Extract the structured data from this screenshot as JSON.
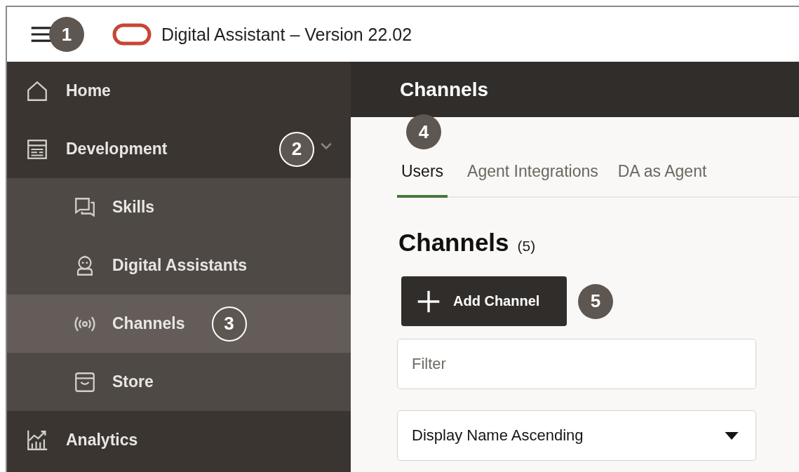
{
  "header": {
    "menu_callout": {
      "number": "1",
      "kind": "filled"
    },
    "title": "Digital Assistant – Version 22.02"
  },
  "sidebar": {
    "items": [
      {
        "label": "Home",
        "kind": "home",
        "selected": false
      },
      {
        "label": "Development",
        "kind": "development",
        "selected": false,
        "expanded": true,
        "callout": {
          "number": "2",
          "kind": "outline"
        },
        "children": [
          {
            "label": "Skills",
            "kind": "skills",
            "selected": false
          },
          {
            "label": "Digital Assistants",
            "kind": "assistant",
            "selected": false
          },
          {
            "label": "Channels",
            "kind": "channels",
            "selected": true,
            "callout": {
              "number": "3",
              "kind": "outline"
            }
          },
          {
            "label": "Store",
            "kind": "store",
            "selected": false
          }
        ]
      },
      {
        "label": "Analytics",
        "kind": "analytics",
        "selected": false
      }
    ]
  },
  "page": {
    "title": "Channels",
    "tabs": [
      {
        "label": "Users",
        "selected": true,
        "callout": {
          "number": "4",
          "kind": "filled"
        }
      },
      {
        "label": "Agent Integrations",
        "selected": false
      },
      {
        "label": "DA as Agent",
        "selected": false
      }
    ],
    "heading": "Channels",
    "count": "(5)",
    "add_button": {
      "label": "Add Channel",
      "callout": {
        "number": "5",
        "kind": "filled"
      }
    },
    "filter": {
      "placeholder": "Filter"
    },
    "sort": {
      "value": "Display Name Ascending"
    }
  }
}
